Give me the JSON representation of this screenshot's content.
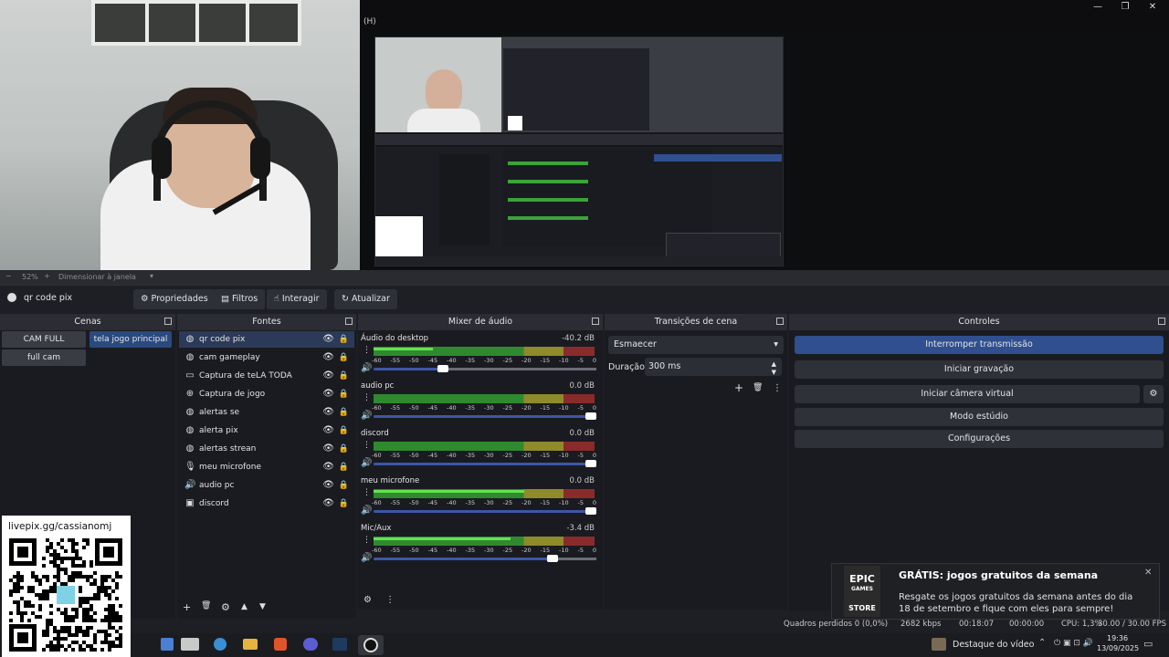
{
  "program": {
    "title": "(H)",
    "window_controls": [
      "—",
      "❐",
      "✕"
    ]
  },
  "zoom_bar": {
    "minus": "−",
    "zoom_value": "52%",
    "plus": "+",
    "scale_mode": "Dimensionar à janela",
    "dropdown": "▾"
  },
  "source_toolbar": {
    "current_source": "qr code pix",
    "properties": "Propriedades",
    "filters": "Filtros",
    "interact": "Interagir",
    "refresh": "Atualizar"
  },
  "scenes": {
    "title": "Cenas",
    "items": [
      "CAM FULL",
      "tela jogo principal",
      "full cam"
    ],
    "active": "tela jogo principal"
  },
  "sources": {
    "title": "Fontes",
    "items": [
      {
        "name": "qr code pix",
        "icon": "globe-icon",
        "selected": true
      },
      {
        "name": "cam gameplay",
        "icon": "globe-icon"
      },
      {
        "name": "Captura de teLA TODA",
        "icon": "monitor-icon"
      },
      {
        "name": "Captura de jogo",
        "icon": "gamepad-icon"
      },
      {
        "name": "alertas se",
        "icon": "globe-icon"
      },
      {
        "name": "alerta pix",
        "icon": "globe-icon"
      },
      {
        "name": "alertas strean",
        "icon": "globe-icon"
      },
      {
        "name": "meu microfone",
        "icon": "mic-icon"
      },
      {
        "name": "audio pc",
        "icon": "speaker-icon"
      },
      {
        "name": "discord",
        "icon": "window-icon"
      }
    ],
    "toolbar": [
      "+",
      "🗑",
      "⚙",
      "▲",
      "▼"
    ]
  },
  "mixer": {
    "title": "Mixer de áudio",
    "tick_labels": [
      "-60",
      "-55",
      "-50",
      "-45",
      "-40",
      "-35",
      "-30",
      "-25",
      "-20",
      "-15",
      "-10",
      "-5",
      "0"
    ],
    "channels": [
      {
        "name": "Áudio do desktop",
        "db": "-40.2 dB",
        "level": 0.27,
        "volume": 0.3
      },
      {
        "name": "audio pc",
        "db": "0.0 dB",
        "level": 0.0,
        "volume": 1.0
      },
      {
        "name": "discord",
        "db": "0.0 dB",
        "level": 0.0,
        "volume": 1.0
      },
      {
        "name": "meu microfone",
        "db": "0.0 dB",
        "level": 0.68,
        "volume": 1.0
      },
      {
        "name": "Mic/Aux",
        "db": "-3.4 dB",
        "level": 0.62,
        "volume": 0.82
      }
    ]
  },
  "transitions": {
    "title": "Transições de cena",
    "selected": "Esmaecer",
    "duration_label": "Duração",
    "duration_value": "300 ms"
  },
  "controls": {
    "title": "Controles",
    "buttons": [
      "Interromper transmissão",
      "Iniciar gravação",
      "Iniciar câmera virtual",
      "Modo estúdio",
      "Configurações"
    ]
  },
  "qr": {
    "label": "livepix.gg/cassianomj"
  },
  "status_bar": {
    "dropped": "Quadros perdidos 0 (0,0%)",
    "bitrate": "2682 kbps",
    "stream_time": "00:18:07",
    "rec_time": "00:00:00",
    "cpu": "CPU: 1,3%",
    "fps": "30.00 / 30.00 FPS"
  },
  "toast": {
    "logo_top": "EPIC",
    "logo_mid": "GAMES",
    "logo_bottom": "STORE",
    "title": "GRÁTIS: jogos gratuitos da semana",
    "body": "Resgate os jogos gratuitos da semana antes do dia 18 de setembro e fique com eles para sempre!",
    "close": "✕"
  },
  "taskbar": {
    "news": "Destaque do vídeo",
    "time": "19:36",
    "date": "13/09/2025"
  }
}
